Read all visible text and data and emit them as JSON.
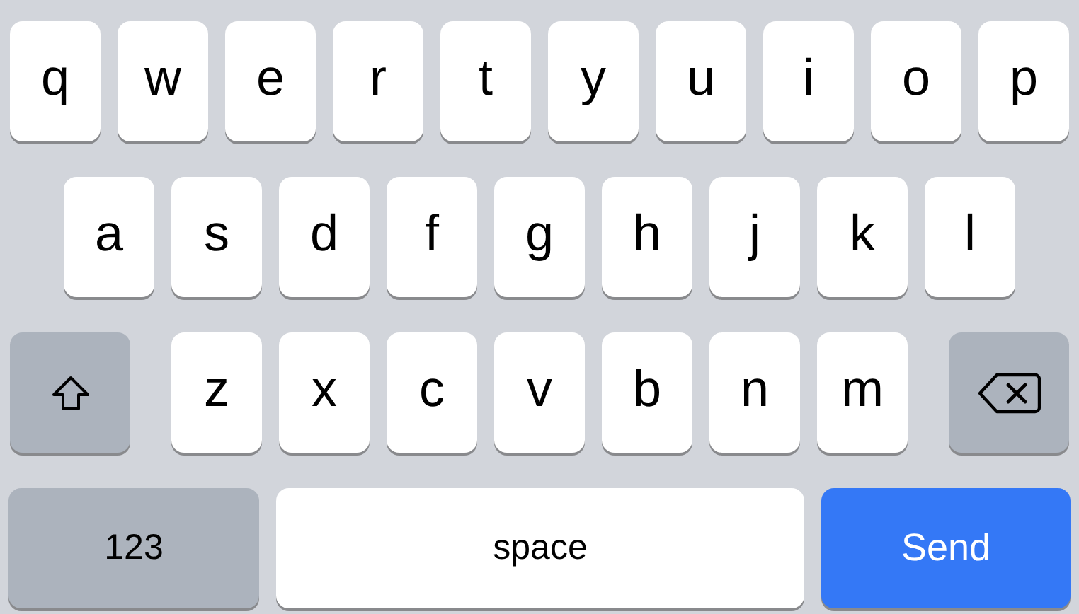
{
  "keyboard": {
    "rows": [
      {
        "keys": [
          {
            "kind": "letter",
            "label": "q"
          },
          {
            "kind": "letter",
            "label": "w"
          },
          {
            "kind": "letter",
            "label": "e"
          },
          {
            "kind": "letter",
            "label": "r"
          },
          {
            "kind": "letter",
            "label": "t"
          },
          {
            "kind": "letter",
            "label": "y"
          },
          {
            "kind": "letter",
            "label": "u"
          },
          {
            "kind": "letter",
            "label": "i"
          },
          {
            "kind": "letter",
            "label": "o"
          },
          {
            "kind": "letter",
            "label": "p"
          }
        ]
      },
      {
        "keys": [
          {
            "kind": "letter",
            "label": "a"
          },
          {
            "kind": "letter",
            "label": "s"
          },
          {
            "kind": "letter",
            "label": "d"
          },
          {
            "kind": "letter",
            "label": "f"
          },
          {
            "kind": "letter",
            "label": "g"
          },
          {
            "kind": "letter",
            "label": "h"
          },
          {
            "kind": "letter",
            "label": "j"
          },
          {
            "kind": "letter",
            "label": "k"
          },
          {
            "kind": "letter",
            "label": "l"
          }
        ]
      },
      {
        "keys": [
          {
            "kind": "shift"
          },
          {
            "kind": "letter",
            "label": "z"
          },
          {
            "kind": "letter",
            "label": "x"
          },
          {
            "kind": "letter",
            "label": "c"
          },
          {
            "kind": "letter",
            "label": "v"
          },
          {
            "kind": "letter",
            "label": "b"
          },
          {
            "kind": "letter",
            "label": "n"
          },
          {
            "kind": "letter",
            "label": "m"
          },
          {
            "kind": "backspace"
          }
        ]
      },
      {
        "keys": [
          {
            "kind": "mode",
            "label": "123"
          },
          {
            "kind": "space",
            "label": "space"
          },
          {
            "kind": "send",
            "label": "Send"
          }
        ]
      }
    ]
  }
}
